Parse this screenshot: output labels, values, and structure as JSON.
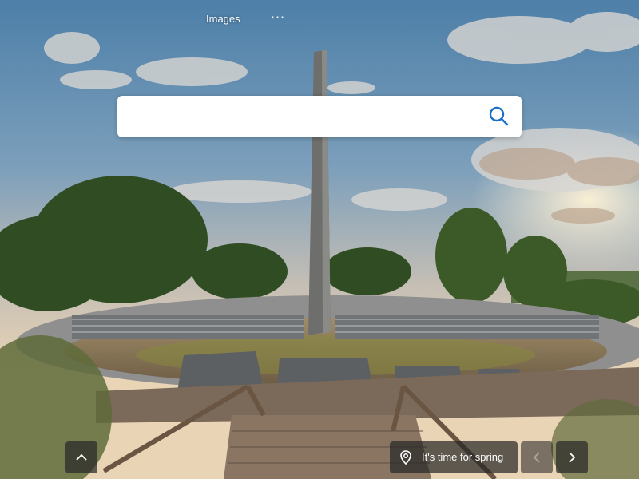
{
  "nav": {
    "images_label": "Images",
    "more_label": "···"
  },
  "search": {
    "value": "",
    "placeholder": ""
  },
  "footer": {
    "caption": "It's time for spring"
  },
  "icons": {
    "search": "search-icon",
    "scroll_up": "chevron-up-icon",
    "location": "location-pin-icon",
    "previous": "chevron-left-icon",
    "next": "chevron-right-icon"
  },
  "colors": {
    "search_icon": "#1a6fc9",
    "overlay_button": "#282828",
    "box_background": "#ffffff"
  }
}
